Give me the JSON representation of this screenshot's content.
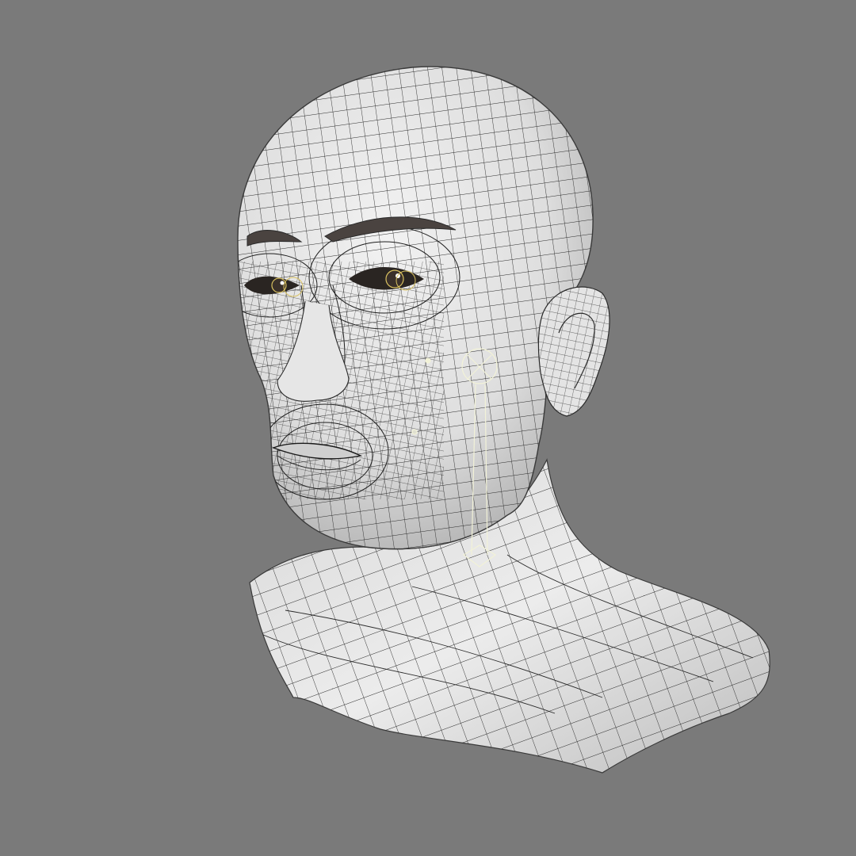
{
  "viewport": {
    "background_color": "#7a7a7a",
    "shading": "wireframe-on-shaded",
    "model": "head-bust"
  },
  "colors": {
    "surface": "#ececec",
    "surface_shadow": "#b5b5b5",
    "wire": "#222222",
    "eye_gizmo": "#d8c060",
    "bone_gizmo": "#f2f2d8"
  }
}
